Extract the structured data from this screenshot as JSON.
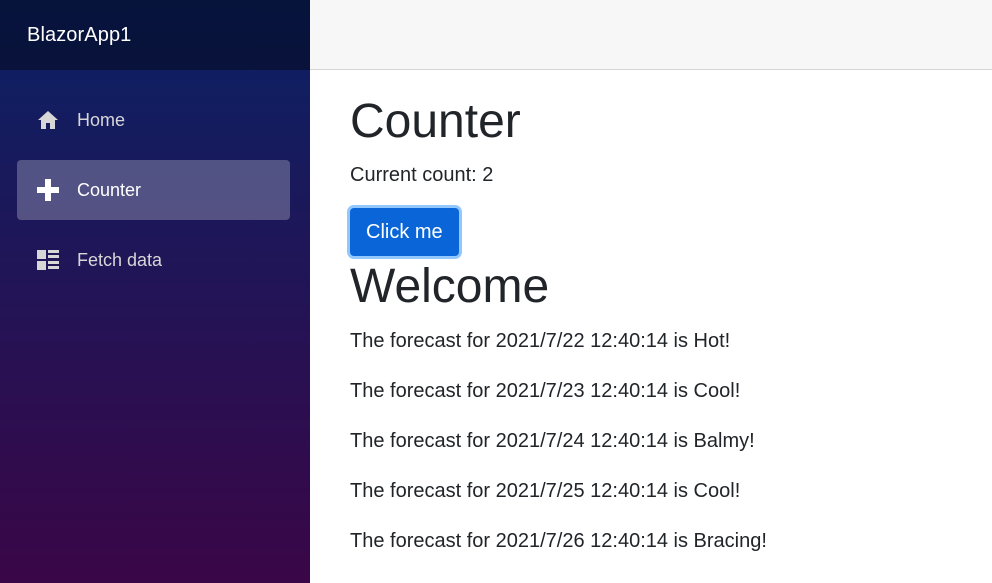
{
  "sidebar": {
    "brand": "BlazorApp1",
    "items": [
      {
        "label": "Home",
        "icon": "home-icon",
        "active": false
      },
      {
        "label": "Counter",
        "icon": "plus-icon",
        "active": true
      },
      {
        "label": "Fetch data",
        "icon": "list-rich-icon",
        "active": false
      }
    ]
  },
  "main": {
    "title": "Counter",
    "count_text": "Current count: 2",
    "button_label": "Click me",
    "welcome_heading": "Welcome",
    "forecasts": [
      "The forecast for 2021/7/22 12:40:14 is Hot!",
      "The forecast for 2021/7/23 12:40:14 is Cool!",
      "The forecast for 2021/7/24 12:40:14 is Balmy!",
      "The forecast for 2021/7/25 12:40:14 is Cool!",
      "The forecast for 2021/7/26 12:40:14 is Bracing!"
    ]
  },
  "colors": {
    "sidebar_top": "#0a2265",
    "sidebar_bottom": "#3a0647",
    "button": "#0a66d8"
  }
}
